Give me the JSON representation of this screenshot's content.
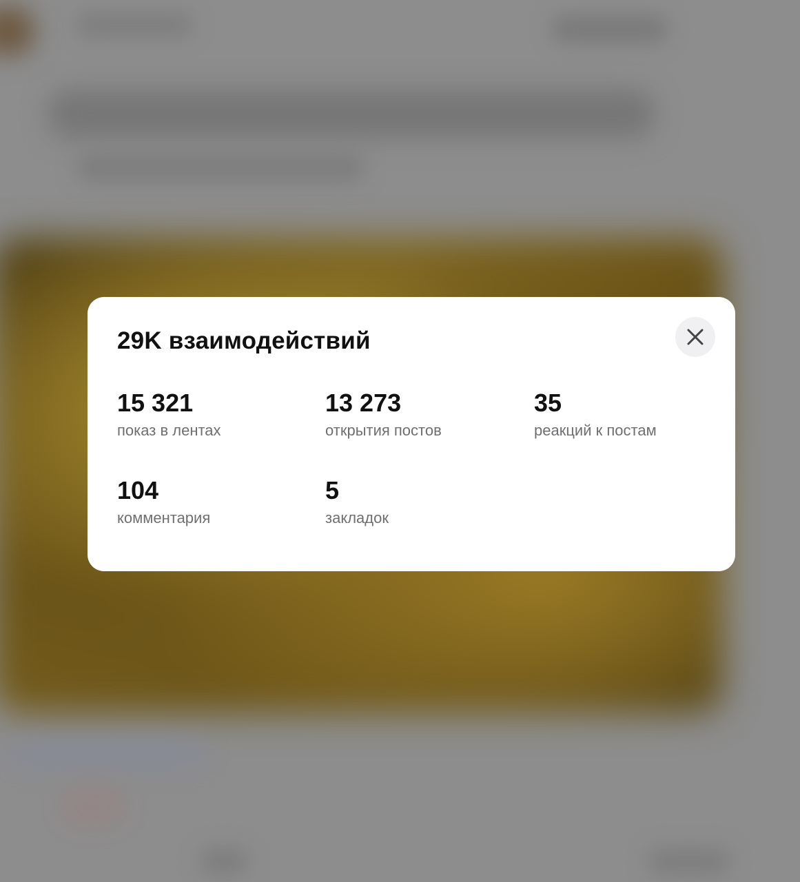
{
  "modal": {
    "title": "29K взаимодействий",
    "close_icon": "close-icon",
    "stats": [
      {
        "value": "15 321",
        "label": "показ в лентах"
      },
      {
        "value": "13 273",
        "label": "открытия постов"
      },
      {
        "value": "35",
        "label": "реакций к постам"
      },
      {
        "value": "104",
        "label": "комментария"
      },
      {
        "value": "5",
        "label": "закладок"
      }
    ]
  },
  "colors": {
    "overlay": "#8d8d8d",
    "modal_background": "#ffffff",
    "title_text": "#111111",
    "label_text": "#6f6f73",
    "close_button_background": "#f0f0f2"
  }
}
